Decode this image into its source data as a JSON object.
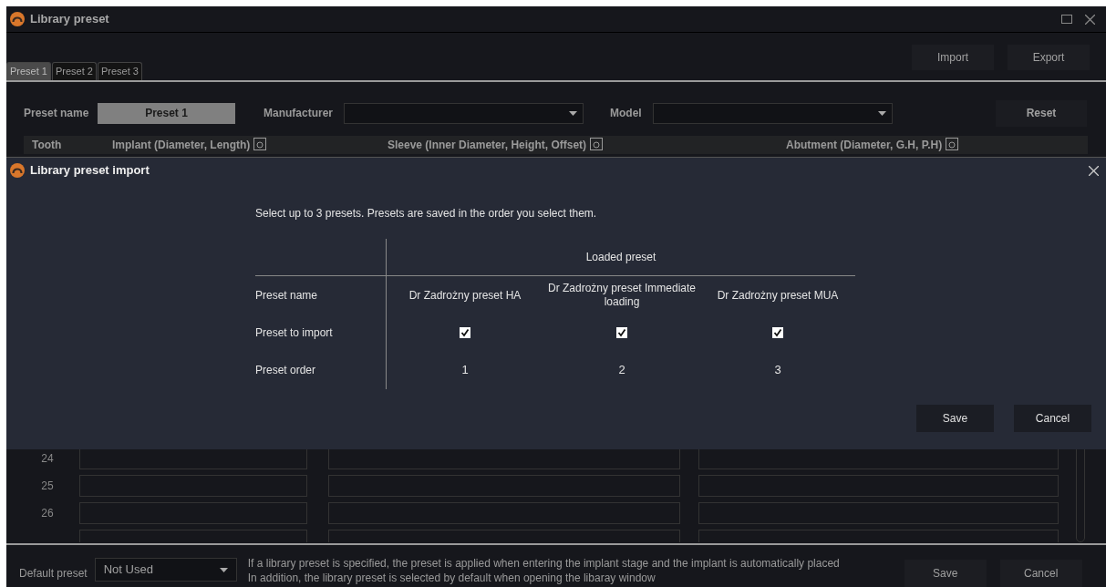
{
  "window": {
    "title": "Library preset"
  },
  "tabs": [
    {
      "label": "Preset 1",
      "selected": true
    },
    {
      "label": "Preset 2",
      "selected": false
    },
    {
      "label": "Preset 3",
      "selected": false
    }
  ],
  "toolbar_buttons": [
    "Import",
    "Export"
  ],
  "preset_form": {
    "name_label": "Preset name",
    "name_value": "Preset 1",
    "manufacturer_label": "Manufacturer",
    "model_label": "Model",
    "reset_button": "Reset"
  },
  "table": {
    "columns": [
      "Tooth",
      "Implant (Diameter, Length)",
      "Sleeve (Inner Diameter, Height, Offset)",
      "Abutment (Diameter, G.H, P.H)"
    ],
    "rows": [
      {
        "tooth": "24"
      },
      {
        "tooth": "25"
      },
      {
        "tooth": "26"
      }
    ]
  },
  "footer": {
    "label": "Default preset",
    "value": "Not Used",
    "info": [
      "If a library preset is specified, the preset is applied when entering the implant stage and the implant is automatically placed",
      "In addition, the library preset is selected by default when opening the libaray window"
    ],
    "buttons": [
      "Save",
      "Cancel"
    ]
  },
  "dialog": {
    "title": "Library preset import",
    "instruction": "Select up to 3 presets. Presets are saved in the order you select them.",
    "group_header": "Loaded preset",
    "row_labels": [
      "Preset name",
      "Preset to import",
      "Preset order"
    ],
    "presets": [
      {
        "name": "Dr Zadrożny preset HA",
        "checked": true,
        "order": "1"
      },
      {
        "name": "Dr Zadrożny preset Immediate loading",
        "checked": true,
        "order": "2"
      },
      {
        "name": "Dr Zadrożny preset MUA",
        "checked": true,
        "order": "3"
      }
    ],
    "buttons": [
      "Save",
      "Cancel"
    ]
  }
}
